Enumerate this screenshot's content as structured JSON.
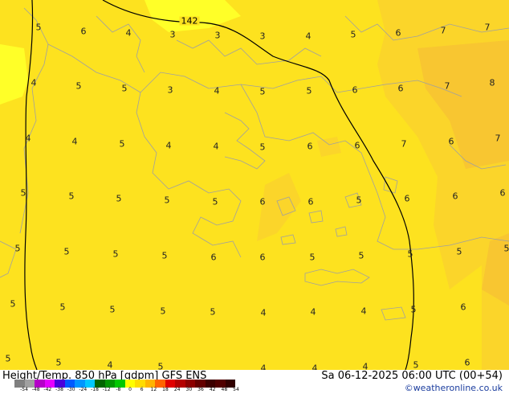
{
  "map": {
    "contour_label": "142",
    "values": [
      [
        "5",
        "6",
        "4",
        "3",
        "3",
        "3",
        "4",
        "5",
        "6",
        "7",
        "7"
      ],
      [
        "4",
        "5",
        "5",
        "3",
        "4",
        "5",
        "5",
        "6",
        "6",
        "7",
        "8"
      ],
      [
        "4",
        "4",
        "5",
        "4",
        "4",
        "5",
        "6",
        "6",
        "7",
        "6",
        "7"
      ],
      [
        "5",
        "5",
        "5",
        "5",
        "5",
        "6",
        "6",
        "5",
        "6",
        "6",
        "6"
      ],
      [
        "5",
        "5",
        "5",
        "5",
        "6",
        "6",
        "5",
        "5",
        "5",
        "5",
        "5"
      ],
      [
        "5",
        "5",
        "5",
        "5",
        "5",
        "4",
        "4",
        "4",
        "5",
        "6"
      ],
      [
        "5",
        "5",
        "4",
        "5",
        "4",
        "4",
        "4",
        "5",
        "6"
      ]
    ],
    "colors": {
      "base": "#fde21f",
      "light": "#ffff28",
      "warm": "#fbd52a",
      "warmer": "#f8c631",
      "land_border": "#a0a0a0",
      "contour": "#000000"
    }
  },
  "footer": {
    "title": "Height/Temp. 850 hPa [gdpm] GFS ENS",
    "datetime": "Sa 06-12-2025 06:00 UTC (00+54)",
    "credit": "©weatheronline.co.uk",
    "scale_ticks": [
      "-54",
      "-48",
      "-42",
      "-38",
      "-30",
      "-24",
      "-18",
      "-12",
      "-8",
      "0",
      "6",
      "12",
      "18",
      "24",
      "30",
      "36",
      "42",
      "48",
      "54"
    ],
    "scale_colors": [
      "#808080",
      "#a0a0a0",
      "#b400c8",
      "#e600ff",
      "#4b00dc",
      "#005aff",
      "#0096ff",
      "#00c8ff",
      "#006400",
      "#009600",
      "#00c800",
      "#ffff00",
      "#ffdc00",
      "#ffb400",
      "#ff6400",
      "#e10000",
      "#b40000",
      "#8c0000",
      "#640000",
      "#3c0000",
      "#500000",
      "#300000"
    ]
  }
}
